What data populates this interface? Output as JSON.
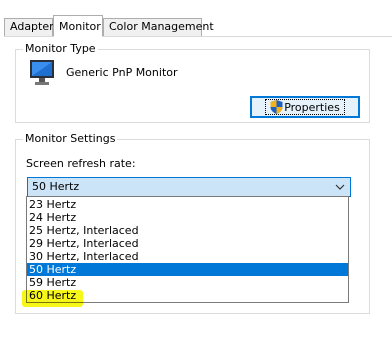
{
  "tabs": [
    {
      "label": "Adapter"
    },
    {
      "label": "Monitor"
    },
    {
      "label": "Color Management"
    }
  ],
  "monitor_type": {
    "title": "Monitor Type",
    "name": "Generic PnP Monitor",
    "properties_label": "Properties"
  },
  "monitor_settings": {
    "title": "Monitor Settings",
    "refresh_label": "Screen refresh rate:",
    "selected_value": "50 Hertz",
    "options": [
      "23 Hertz",
      "24 Hertz",
      "25 Hertz, Interlaced",
      "29 Hertz, Interlaced",
      "30 Hertz, Interlaced",
      "50 Hertz",
      "59 Hertz",
      "60 Hertz"
    ],
    "selected_index": 5,
    "highlighted_index": 7
  },
  "colors": {
    "accent": "#0078d7",
    "combo_bg": "#cce4f7",
    "highlighter": "#f6f500"
  },
  "icons": [
    "monitor-icon",
    "shield-icon",
    "chevron-down-icon"
  ]
}
